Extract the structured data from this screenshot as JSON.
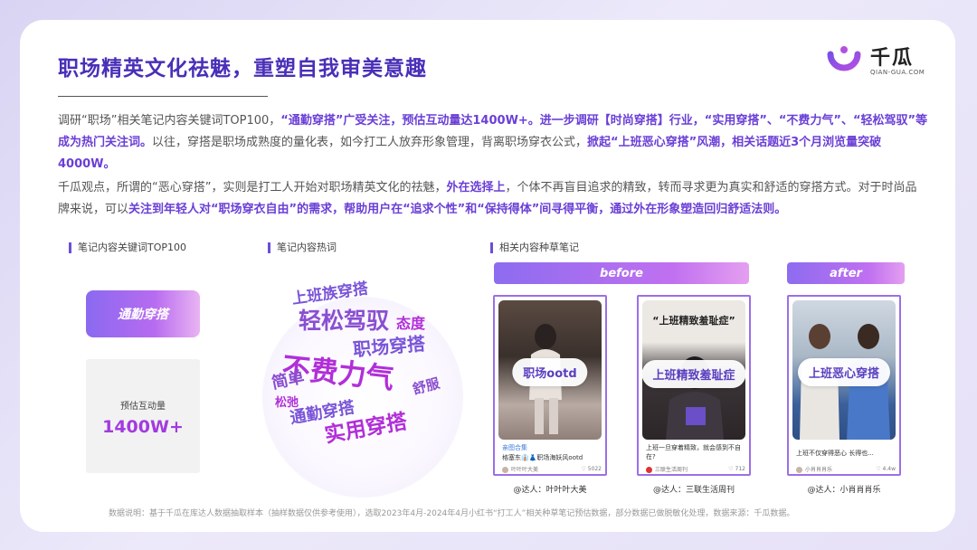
{
  "header": {
    "title": "职场精英文化祛魅，重塑自我审美意趣",
    "logo_text": "千瓜",
    "logo_sub": "QIAN-GUA.COM"
  },
  "intro": {
    "p1_a": "调研“职场”相关笔记内容关键词TOP100，",
    "p1_b": "“通勤穿搭”广受关注，预估互动量达1400W+。进一步调研【时尚穿搭】行业，“实用穿搭”、“不费力气”、“轻松驾驭”等成为热门关注词。",
    "p1_c": "以往，穿搭是职场成熟度的量化表，如今打工人放弃形象管理，背离职场穿衣公式，",
    "p1_d": "掀起“上班恶心穿搭”风潮，相关话题近3个月浏览量突破4000W。",
    "p2_a": "千瓜观点，所谓的“恶心穿搭”，实则是打工人开始对职场精英文化的祛魅，",
    "p2_b": "外在选择上",
    "p2_c": "，个体不再盲目追求的精致，转而寻求更为真实和舒适的穿搭方式。对于时尚品牌来说，可以",
    "p2_d": "关注到年轻人对“职场穿衣自由”的需求，帮助用户在“追求个性”和“保持得体”间寻得平衡，通过外在形象塑造回归舒适法则。"
  },
  "keywords": {
    "label": "笔记内容关键词TOP100",
    "top_keyword": "通勤穿搭",
    "stat_label": "预估互动量",
    "stat_value": "1400W+"
  },
  "wordcloud": {
    "label": "笔记内容热词",
    "words": [
      "上班族穿搭",
      "轻松驾驭",
      "态度",
      "职场穿搭",
      "不费力气",
      "简单",
      "舒服",
      "松弛",
      "通勤穿搭",
      "实用穿搭"
    ]
  },
  "notes": {
    "label": "相关内容种草笔记",
    "before": "before",
    "after": "after",
    "items": [
      {
        "tag": "职场ootd",
        "badge": "亲图合集",
        "caption": "格塞东👔👗职场海妖风ootd",
        "author": "叶叶叶大美",
        "likes": "5022",
        "credit": "@达人：叶叶叶大美"
      },
      {
        "tag": "上班精致羞耻症",
        "headline": "“上班精致羞耻症”",
        "caption": "上班一旦穿着精致，就会感到不自在?",
        "author": "三联生活周刊",
        "likes": "712",
        "credit": "@达人：三联生活周刊"
      },
      {
        "tag": "上班恶心穿搭",
        "caption": "上班不仅穿得恶心 长得也...",
        "author": "小肖肖肖乐",
        "likes": "4.4w",
        "credit": "@达人：小肖肖肖乐"
      }
    ]
  },
  "footnote": "数据说明：基于千瓜在库达人数据抽取样本（抽样数据仅供参考使用），选取2023年4月-2024年4月小红书“打工人”相关种草笔记预估数据，部分数据已做脱敏化处理，数据来源：千瓜数据。",
  "colors": {
    "accent": "#4a2fb8",
    "purple": "#6a3fd6",
    "magenta": "#b12fd8"
  }
}
